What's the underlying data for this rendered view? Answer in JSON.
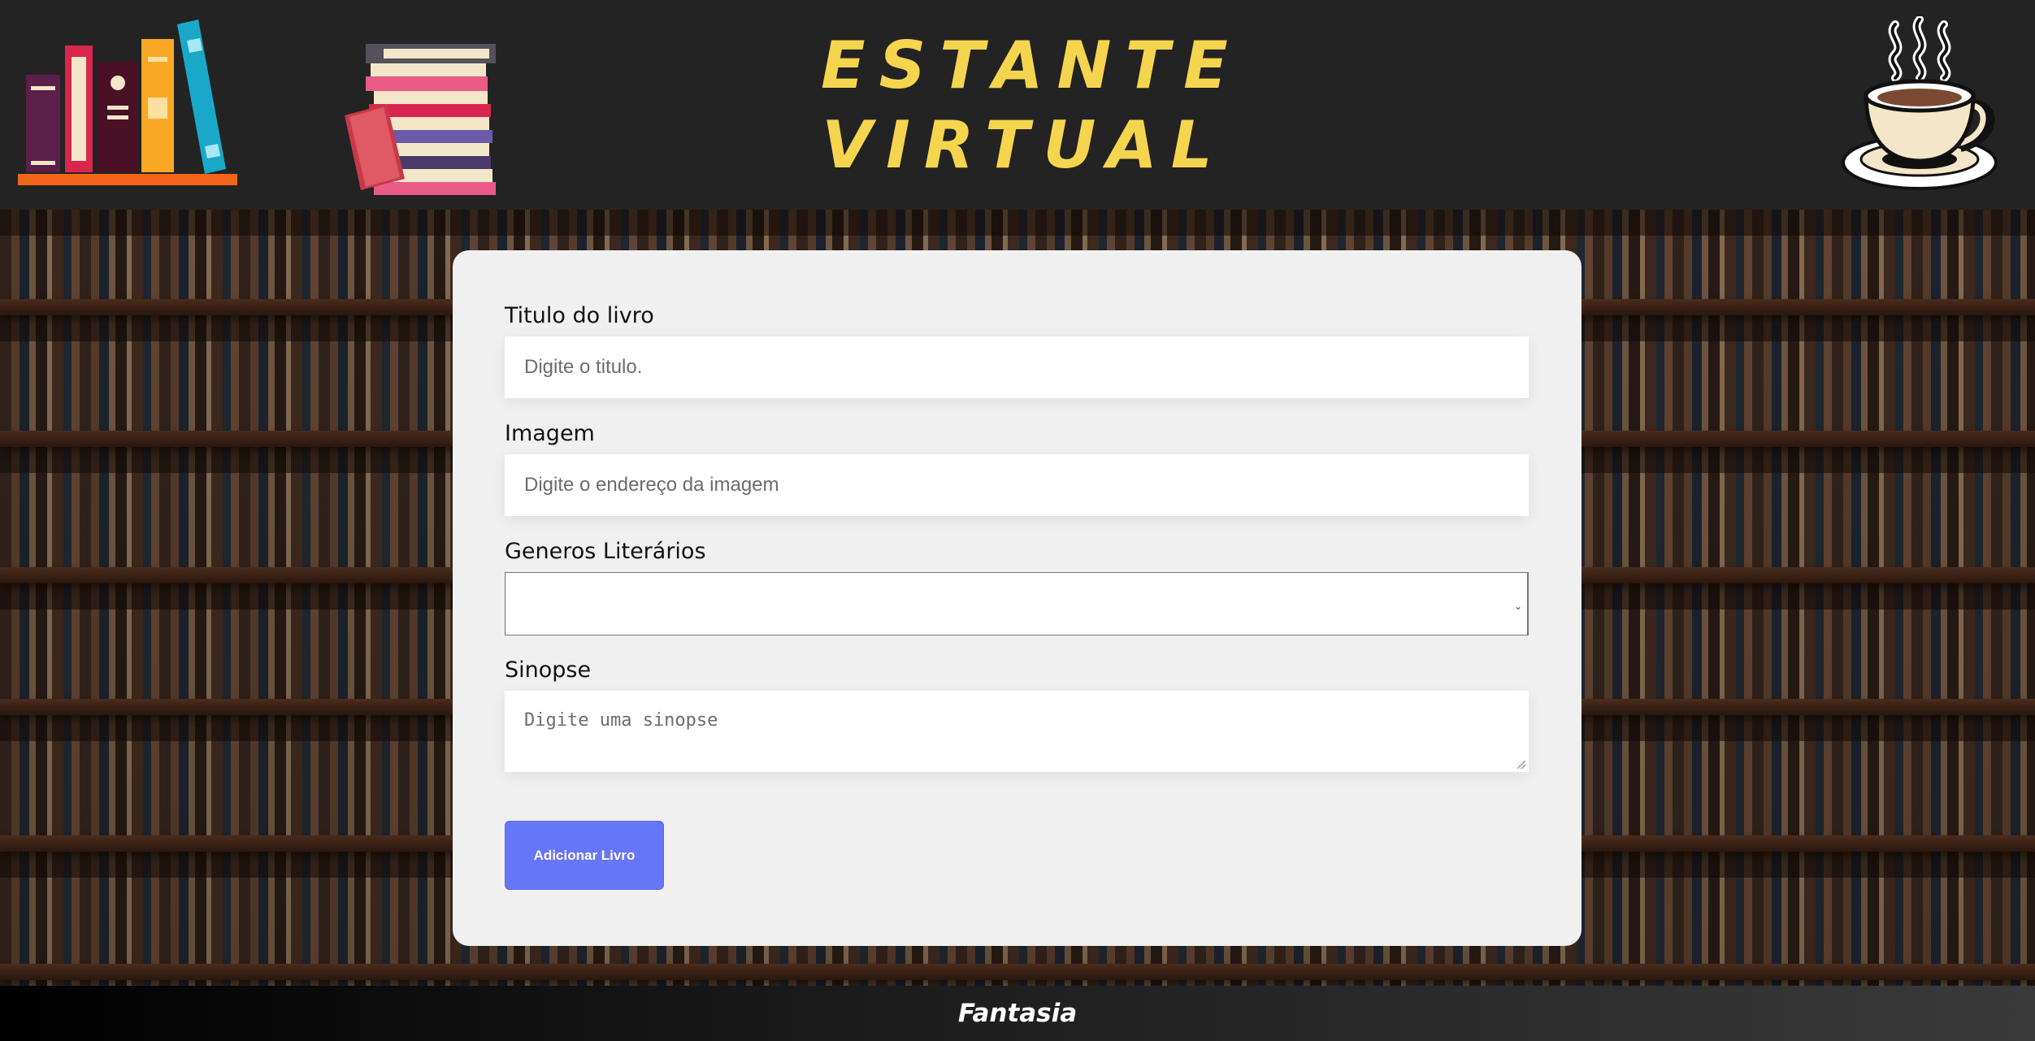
{
  "header": {
    "title_line1": "ESTANTE",
    "title_line2": "VIRTUAL",
    "logo_left_icon": "book-shelf-icon",
    "logo_middle_icon": "book-stack-icon",
    "logo_right_icon": "coffee-cup-icon",
    "title_color": "#f6d54e",
    "background_color": "#232323"
  },
  "form": {
    "title_field": {
      "label": "Titulo do livro",
      "value": "",
      "placeholder": "Digite o titulo."
    },
    "image_field": {
      "label": "Imagem",
      "value": "",
      "placeholder": "Digite o endereço da imagem"
    },
    "genre_field": {
      "label": "Generos Literários",
      "selected": ""
    },
    "synopsis_field": {
      "label": "Sinopse",
      "value": "",
      "placeholder": "Digite uma sinopse"
    },
    "submit_label": "Adicionar Livro",
    "button_color": "#6676f8",
    "card_color": "#f0f0f0"
  },
  "footer": {
    "text": "Fantasia"
  }
}
